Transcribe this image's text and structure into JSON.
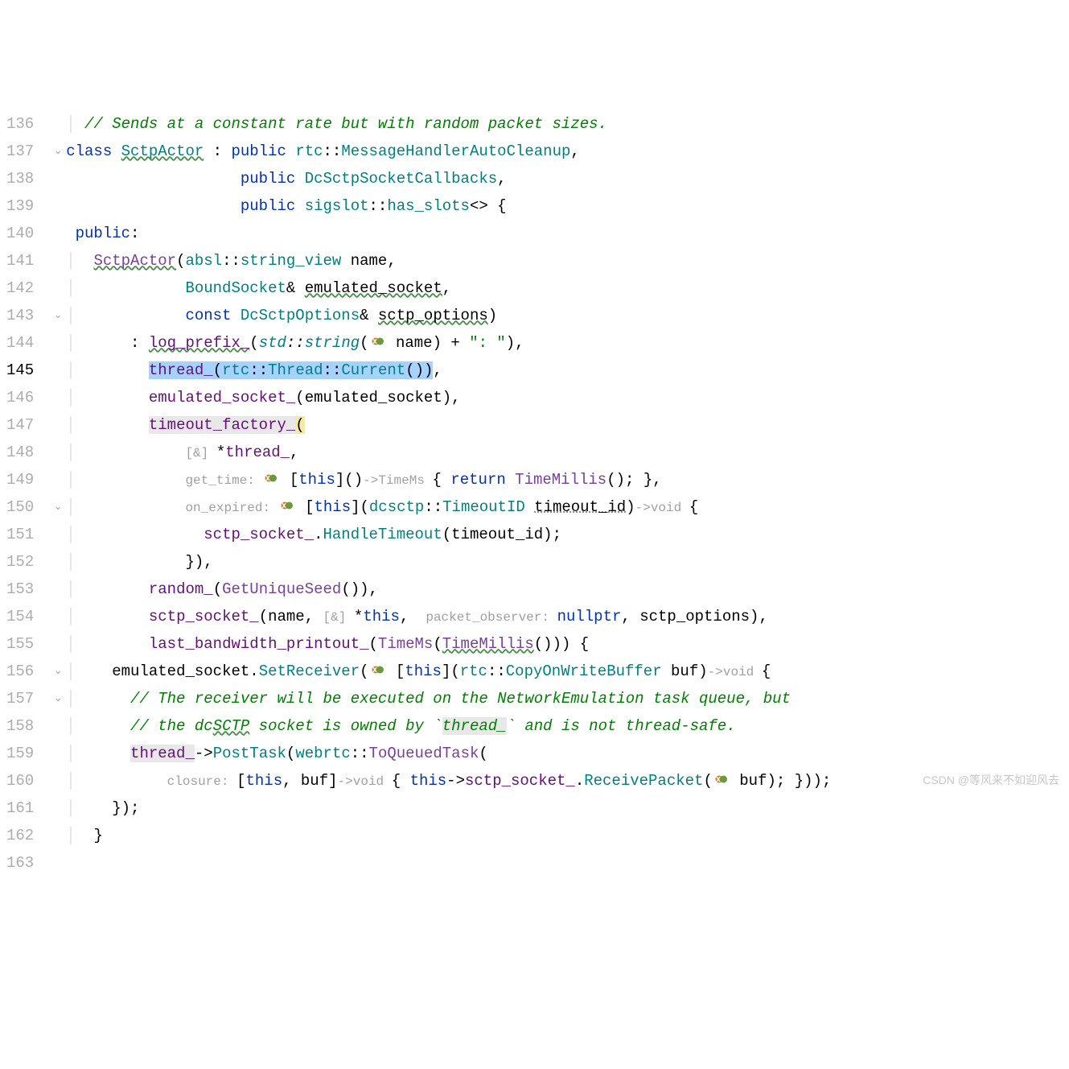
{
  "line_start": 136,
  "line_end": 163,
  "current_line": 145,
  "fold_markers": {
    "137": "v",
    "143": "v",
    "150": "v",
    "156": "v",
    "157": "v"
  },
  "code": {
    "136": {
      "indent": 1,
      "tokens": [
        [
          "comment",
          "// Sends at a constant rate but with random packet sizes."
        ]
      ]
    },
    "137": {
      "indent": 0,
      "tokens": [
        [
          "keyword",
          "class"
        ],
        [
          "sp",
          " "
        ],
        [
          "class-ul",
          "SctpActor"
        ],
        [
          "sp",
          " "
        ],
        [
          "op",
          ":"
        ],
        [
          "sp",
          " "
        ],
        [
          "keyword",
          "public"
        ],
        [
          "sp",
          " "
        ],
        [
          "ns",
          "rtc"
        ],
        [
          "op",
          "::"
        ],
        [
          "type",
          "MessageHandlerAutoCleanup"
        ],
        [
          "op",
          ","
        ]
      ]
    },
    "138": {
      "indent": 0,
      "tokens": [
        [
          "sp",
          "                   "
        ],
        [
          "keyword",
          "public"
        ],
        [
          "sp",
          " "
        ],
        [
          "type",
          "DcSctpSocketCallbacks"
        ],
        [
          "op",
          ","
        ]
      ]
    },
    "139": {
      "indent": 0,
      "tokens": [
        [
          "sp",
          "                   "
        ],
        [
          "keyword",
          "public"
        ],
        [
          "sp",
          " "
        ],
        [
          "ns",
          "sigslot"
        ],
        [
          "op",
          "::"
        ],
        [
          "type",
          "has_slots"
        ],
        [
          "op",
          "<> {"
        ]
      ]
    },
    "140": {
      "indent": 0,
      "tokens": [
        [
          "sp",
          " "
        ],
        [
          "keyword",
          "public"
        ],
        [
          "op",
          ":"
        ]
      ]
    },
    "141": {
      "indent": 1,
      "tokens": [
        [
          "sp",
          " "
        ],
        [
          "func-ul",
          "SctpActor"
        ],
        [
          "op",
          "("
        ],
        [
          "ns",
          "absl"
        ],
        [
          "op",
          "::"
        ],
        [
          "type",
          "string_view"
        ],
        [
          "sp",
          " "
        ],
        [
          "param",
          "name"
        ],
        [
          "op",
          ","
        ]
      ]
    },
    "142": {
      "indent": 1,
      "tokens": [
        [
          "sp",
          "           "
        ],
        [
          "type",
          "BoundSocket"
        ],
        [
          "op",
          "& "
        ],
        [
          "param-ul",
          "emulated_socket"
        ],
        [
          "op",
          ","
        ]
      ]
    },
    "143": {
      "indent": 1,
      "tokens": [
        [
          "sp",
          "           "
        ],
        [
          "keyword",
          "const"
        ],
        [
          "sp",
          " "
        ],
        [
          "type",
          "DcSctpOptions"
        ],
        [
          "op",
          "& "
        ],
        [
          "param-ul",
          "sctp_options"
        ],
        [
          "op",
          ")"
        ]
      ]
    },
    "144": {
      "indent": 1,
      "tokens": [
        [
          "sp",
          "     "
        ],
        [
          "op",
          ":"
        ],
        [
          "sp",
          " "
        ],
        [
          "field-ul",
          "log_prefix_"
        ],
        [
          "op",
          "("
        ],
        [
          "ns-it",
          "std"
        ],
        [
          "op-it",
          "::"
        ],
        [
          "type-it",
          "string"
        ],
        [
          "op",
          "("
        ],
        [
          "icon",
          "lambda"
        ],
        [
          "sp",
          " "
        ],
        [
          "param",
          "name"
        ],
        [
          "op",
          ")"
        ],
        [
          "sp",
          " "
        ],
        [
          "op",
          "+"
        ],
        [
          "sp",
          " "
        ],
        [
          "string",
          "\": \""
        ],
        [
          "op",
          "),"
        ]
      ]
    },
    "145": {
      "indent": 1,
      "tokens": [
        [
          "sp",
          "       "
        ],
        [
          "field-sel",
          "thread_"
        ],
        [
          "sel",
          "("
        ],
        [
          "ns-sel",
          "rtc"
        ],
        [
          "sel",
          "::"
        ],
        [
          "type-sel",
          "Thread"
        ],
        [
          "sel",
          "::"
        ],
        [
          "method-sel",
          "Current"
        ],
        [
          "sel",
          "()"
        ],
        [
          "sel-end",
          ")"
        ],
        [
          "op",
          ","
        ]
      ]
    },
    "146": {
      "indent": 1,
      "tokens": [
        [
          "sp",
          "       "
        ],
        [
          "field",
          "emulated_socket_"
        ],
        [
          "op",
          "("
        ],
        [
          "param",
          "emulated_socket"
        ],
        [
          "op",
          "),"
        ]
      ]
    },
    "147": {
      "indent": 1,
      "tokens": [
        [
          "sp",
          "       "
        ],
        [
          "field-hl",
          "timeout_factory_"
        ],
        [
          "op-hl",
          "("
        ]
      ]
    },
    "148": {
      "indent": 1,
      "tokens": [
        [
          "sp",
          "           "
        ],
        [
          "hint",
          "[&] "
        ],
        [
          "op",
          "*"
        ],
        [
          "field",
          "thread_"
        ],
        [
          "op",
          ","
        ]
      ]
    },
    "149": {
      "indent": 1,
      "tokens": [
        [
          "sp",
          "           "
        ],
        [
          "hint",
          "get_time: "
        ],
        [
          "icon",
          "lambda"
        ],
        [
          "sp",
          " "
        ],
        [
          "op",
          "["
        ],
        [
          "this",
          "this"
        ],
        [
          "op",
          "]()"
        ],
        [
          "lret",
          "->TimeMs "
        ],
        [
          "op",
          "{"
        ],
        [
          "sp",
          " "
        ],
        [
          "keyword",
          "return"
        ],
        [
          "sp",
          " "
        ],
        [
          "func",
          "TimeMillis"
        ],
        [
          "op",
          "();"
        ],
        [
          "sp",
          " "
        ],
        [
          "op",
          "},"
        ]
      ]
    },
    "150": {
      "indent": 1,
      "tokens": [
        [
          "sp",
          "           "
        ],
        [
          "hint",
          "on_expired: "
        ],
        [
          "icon",
          "lambda"
        ],
        [
          "sp",
          " "
        ],
        [
          "op",
          "["
        ],
        [
          "this",
          "this"
        ],
        [
          "op",
          "]("
        ],
        [
          "ns",
          "dcsctp"
        ],
        [
          "op",
          "::"
        ],
        [
          "type",
          "TimeoutID"
        ],
        [
          "sp",
          " "
        ],
        [
          "param-dot",
          "timeout_id"
        ],
        [
          "op",
          ")"
        ],
        [
          "lret",
          "->void "
        ],
        [
          "op",
          "{"
        ]
      ]
    },
    "151": {
      "indent": 1,
      "tokens": [
        [
          "sp",
          "             "
        ],
        [
          "field",
          "sctp_socket_"
        ],
        [
          "op",
          "."
        ],
        [
          "method",
          "HandleTimeout"
        ],
        [
          "op",
          "("
        ],
        [
          "param",
          "timeout_id"
        ],
        [
          "op",
          ");"
        ]
      ]
    },
    "152": {
      "indent": 1,
      "tokens": [
        [
          "sp",
          "           "
        ],
        [
          "op",
          "}),"
        ]
      ]
    },
    "153": {
      "indent": 1,
      "tokens": [
        [
          "sp",
          "       "
        ],
        [
          "field",
          "random_"
        ],
        [
          "op",
          "("
        ],
        [
          "func",
          "GetUniqueSeed"
        ],
        [
          "op",
          "()),"
        ]
      ]
    },
    "154": {
      "indent": 1,
      "tokens": [
        [
          "sp",
          "       "
        ],
        [
          "field",
          "sctp_socket_"
        ],
        [
          "op",
          "("
        ],
        [
          "param",
          "name"
        ],
        [
          "op",
          ", "
        ],
        [
          "hint",
          "[&] "
        ],
        [
          "op",
          "*"
        ],
        [
          "this",
          "this"
        ],
        [
          "op",
          ", "
        ],
        [
          "hint",
          " packet_observer: "
        ],
        [
          "keyword",
          "nullptr"
        ],
        [
          "op",
          ", "
        ],
        [
          "param",
          "sctp_options"
        ],
        [
          "op",
          "),"
        ]
      ]
    },
    "155": {
      "indent": 1,
      "tokens": [
        [
          "sp",
          "       "
        ],
        [
          "field",
          "last_bandwidth_printout_"
        ],
        [
          "op",
          "("
        ],
        [
          "func",
          "TimeMs"
        ],
        [
          "op",
          "("
        ],
        [
          "func-ul",
          "TimeMillis"
        ],
        [
          "op",
          "())) {"
        ]
      ]
    },
    "156": {
      "indent": 1,
      "tokens": [
        [
          "sp",
          "   "
        ],
        [
          "param",
          "emulated_socket"
        ],
        [
          "op",
          "."
        ],
        [
          "method",
          "SetReceiver"
        ],
        [
          "op",
          "("
        ],
        [
          "icon",
          "lambda"
        ],
        [
          "sp",
          " "
        ],
        [
          "op",
          "["
        ],
        [
          "this",
          "this"
        ],
        [
          "op",
          "]("
        ],
        [
          "ns",
          "rtc"
        ],
        [
          "op",
          "::"
        ],
        [
          "type",
          "CopyOnWriteBuffer"
        ],
        [
          "sp",
          " "
        ],
        [
          "param",
          "buf"
        ],
        [
          "op",
          ")"
        ],
        [
          "lret",
          "->void "
        ],
        [
          "op",
          "{"
        ]
      ]
    },
    "157": {
      "indent": 1,
      "tokens": [
        [
          "sp",
          "     "
        ],
        [
          "comment",
          "// The receiver will be executed on the NetworkEmulation task queue, but"
        ]
      ]
    },
    "158": {
      "indent": 1,
      "tokens": [
        [
          "sp",
          "     "
        ],
        [
          "comment",
          "// the dc"
        ],
        [
          "comment-ul",
          "SCTP"
        ],
        [
          "comment",
          " socket is owned by `"
        ],
        [
          "comment-hl",
          "thread_"
        ],
        [
          "comment",
          "` and is not thread-safe."
        ]
      ]
    },
    "159": {
      "indent": 1,
      "tokens": [
        [
          "sp",
          "     "
        ],
        [
          "field-hl",
          "thread_"
        ],
        [
          "op",
          "->"
        ],
        [
          "method",
          "PostTask"
        ],
        [
          "op",
          "("
        ],
        [
          "ns",
          "webrtc"
        ],
        [
          "op",
          "::"
        ],
        [
          "func",
          "ToQueuedTask"
        ],
        [
          "op",
          "("
        ]
      ]
    },
    "160": {
      "indent": 1,
      "tokens": [
        [
          "sp",
          "         "
        ],
        [
          "hint",
          "closure: "
        ],
        [
          "op",
          "["
        ],
        [
          "this",
          "this"
        ],
        [
          "op",
          ", "
        ],
        [
          "param",
          "buf"
        ],
        [
          "op",
          "]"
        ],
        [
          "lret",
          "->void "
        ],
        [
          "op",
          "{"
        ],
        [
          "sp",
          " "
        ],
        [
          "this",
          "this"
        ],
        [
          "op",
          "->"
        ],
        [
          "field",
          "sctp_socket_"
        ],
        [
          "op",
          "."
        ],
        [
          "method",
          "ReceivePacket"
        ],
        [
          "op",
          "("
        ],
        [
          "icon",
          "lambda"
        ],
        [
          "sp",
          " "
        ],
        [
          "param",
          "buf"
        ],
        [
          "op",
          "); }));"
        ]
      ]
    },
    "161": {
      "indent": 1,
      "tokens": [
        [
          "sp",
          "   "
        ],
        [
          "op",
          "});"
        ]
      ]
    },
    "162": {
      "indent": 1,
      "tokens": [
        [
          "sp",
          " "
        ],
        [
          "op",
          "}"
        ]
      ]
    },
    "163": {
      "indent": 0,
      "tokens": []
    }
  },
  "watermark": "CSDN @等风来不如迎风去"
}
